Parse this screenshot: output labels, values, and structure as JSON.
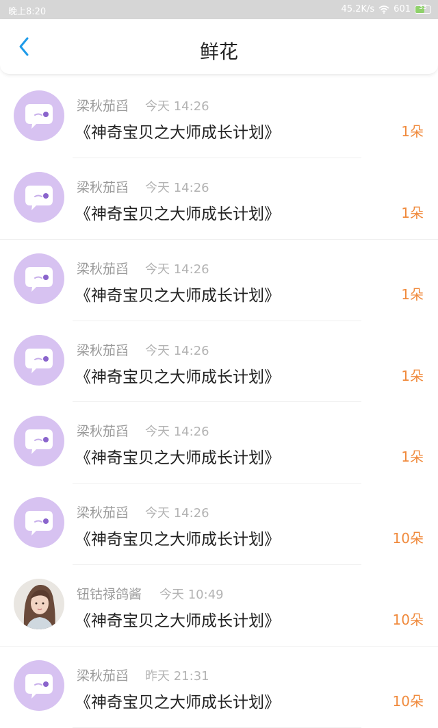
{
  "status": {
    "time": "晚上8:20",
    "speed": "45.2K/s",
    "signal": "601",
    "battery": "33"
  },
  "header": {
    "title": "鲜花"
  },
  "items": [
    {
      "username": "梁秋茄舀",
      "time": "今天 14:26",
      "book": "《神奇宝贝之大师成长计划》",
      "amount": "1朵",
      "avatar": "default-purple"
    },
    {
      "username": "梁秋茄舀",
      "time": "今天 14:26",
      "book": "《神奇宝贝之大师成长计划》",
      "amount": "1朵",
      "avatar": "default-purple"
    },
    {
      "username": "梁秋茄舀",
      "time": "今天 14:26",
      "book": "《神奇宝贝之大师成长计划》",
      "amount": "1朵",
      "avatar": "default-purple"
    },
    {
      "username": "梁秋茄舀",
      "time": "今天 14:26",
      "book": "《神奇宝贝之大师成长计划》",
      "amount": "1朵",
      "avatar": "default-purple"
    },
    {
      "username": "梁秋茄舀",
      "time": "今天 14:26",
      "book": "《神奇宝贝之大师成长计划》",
      "amount": "1朵",
      "avatar": "default-purple"
    },
    {
      "username": "梁秋茄舀",
      "time": "今天 14:26",
      "book": "《神奇宝贝之大师成长计划》",
      "amount": "10朵",
      "avatar": "default-purple"
    },
    {
      "username": "钮钴禄鸽酱",
      "time": "今天 10:49",
      "book": "《神奇宝贝之大师成长计划》",
      "amount": "10朵",
      "avatar": "photo-girl"
    },
    {
      "username": "梁秋茄舀",
      "time": "昨天 21:31",
      "book": "《神奇宝贝之大师成长计划》",
      "amount": "10朵",
      "avatar": "default-purple"
    }
  ],
  "colors": {
    "accent": "#1e9be9",
    "amount": "#f08a3c",
    "avatar_bg": "#d7c2f1"
  }
}
